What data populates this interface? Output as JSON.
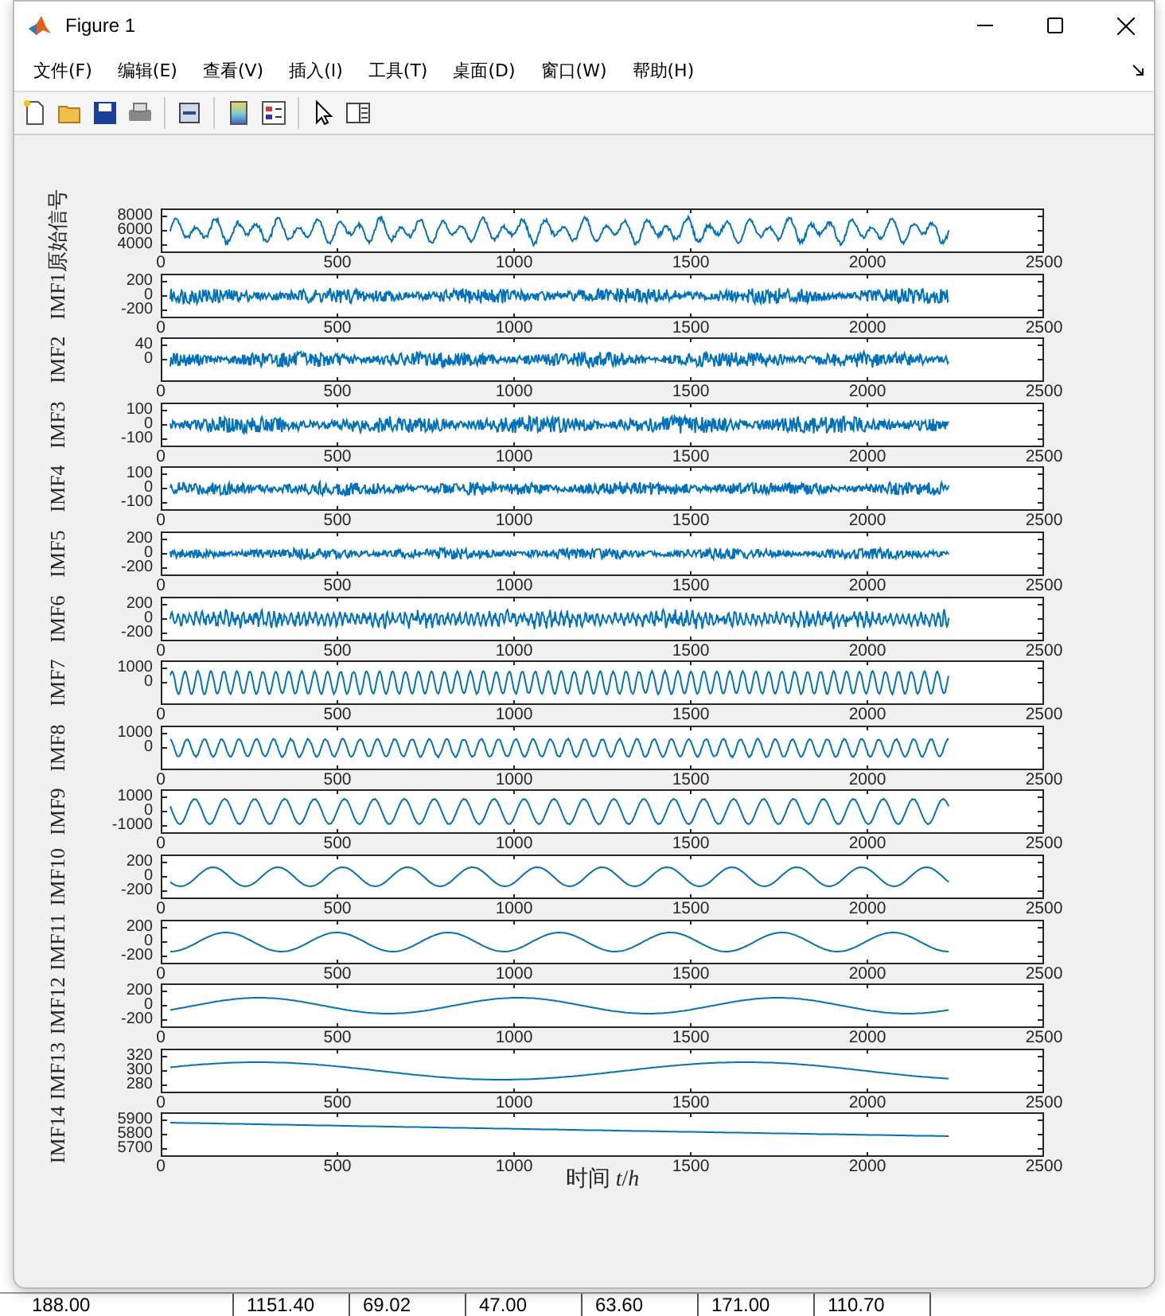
{
  "backdrop": {
    "cells": [
      "188.00",
      "1151.40",
      "69.02",
      "47.00",
      "63.60",
      "171.00",
      "110.70"
    ]
  },
  "window": {
    "title": "Figure 1"
  },
  "menu": [
    "文件(F)",
    "编辑(E)",
    "查看(V)",
    "插入(I)",
    "工具(T)",
    "桌面(D)",
    "窗口(W)",
    "帮助(H)"
  ],
  "subplots": [
    {
      "ylabel": "原始信号",
      "yticks": [
        "8000",
        "6000",
        "4000"
      ],
      "xticks": [
        "0",
        "500",
        "1000",
        "1500",
        "2000",
        "2500"
      ]
    },
    {
      "ylabel": "IMF1",
      "yticks": [
        "200",
        "0",
        "-200"
      ],
      "xticks": [
        "0",
        "500",
        "1000",
        "1500",
        "2000",
        "2500"
      ]
    },
    {
      "ylabel": "IMF2",
      "yticks": [
        "40",
        "0"
      ],
      "xticks": [
        "0",
        "500",
        "1000",
        "1500",
        "2000",
        "2500"
      ]
    },
    {
      "ylabel": "IMF3",
      "yticks": [
        "100",
        "0",
        "-100"
      ],
      "xticks": [
        "0",
        "500",
        "1000",
        "1500",
        "2000",
        "2500"
      ]
    },
    {
      "ylabel": "IMF4",
      "yticks": [
        "100",
        "0",
        "-100"
      ],
      "xticks": [
        "0",
        "500",
        "1000",
        "1500",
        "2000",
        "2500"
      ]
    },
    {
      "ylabel": "IMF5",
      "yticks": [
        "200",
        "0",
        "-200"
      ],
      "xticks": [
        "0",
        "500",
        "1000",
        "1500",
        "2000",
        "2500"
      ]
    },
    {
      "ylabel": "IMF6",
      "yticks": [
        "200",
        "0",
        "-200"
      ],
      "xticks": [
        "0",
        "500",
        "1000",
        "1500",
        "2000",
        "2500"
      ]
    },
    {
      "ylabel": "IMF7",
      "yticks": [
        "1000",
        "0"
      ],
      "xticks": [
        "0",
        "500",
        "1000",
        "1500",
        "2000",
        "2500"
      ]
    },
    {
      "ylabel": "IMF8",
      "yticks": [
        "1000",
        "0"
      ],
      "xticks": [
        "0",
        "500",
        "1000",
        "1500",
        "2000",
        "2500"
      ]
    },
    {
      "ylabel": "IMF9",
      "yticks": [
        "1000",
        "0",
        "-1000"
      ],
      "xticks": [
        "0",
        "500",
        "1000",
        "1500",
        "2000",
        "2500"
      ]
    },
    {
      "ylabel": "IMF10",
      "yticks": [
        "200",
        "0",
        "-200"
      ],
      "xticks": [
        "0",
        "500",
        "1000",
        "1500",
        "2000",
        "2500"
      ]
    },
    {
      "ylabel": "IMF11",
      "yticks": [
        "200",
        "0",
        "-200"
      ],
      "xticks": [
        "0",
        "500",
        "1000",
        "1500",
        "2000",
        "2500"
      ]
    },
    {
      "ylabel": "IMF12",
      "yticks": [
        "200",
        "0",
        "-200"
      ],
      "xticks": [
        "0",
        "500",
        "1000",
        "1500",
        "2000",
        "2500"
      ]
    },
    {
      "ylabel": "IMF13",
      "yticks": [
        "320",
        "300",
        "280"
      ],
      "xticks": [
        "0",
        "500",
        "1000",
        "1500",
        "2000",
        "2500"
      ]
    },
    {
      "ylabel": "IMF14",
      "yticks": [
        "5900",
        "5800",
        "5700"
      ],
      "xticks": [
        "0",
        "500",
        "1000",
        "1500",
        "2000",
        "2500"
      ]
    }
  ],
  "xlabel": "时间 *t*/*h*"
}
